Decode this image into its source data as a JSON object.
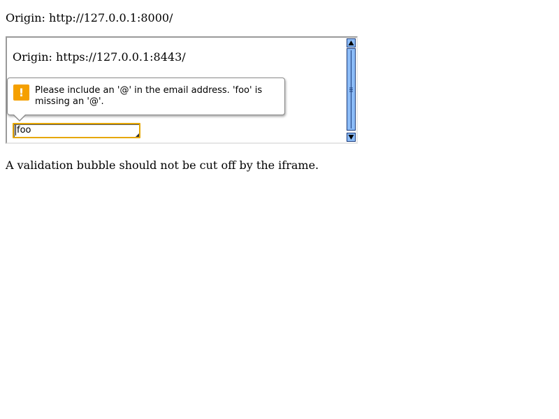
{
  "outer": {
    "origin_text": "Origin: http://127.0.0.1:8000/"
  },
  "iframe": {
    "origin_text": "Origin: https://127.0.0.1:8443/",
    "email_input": {
      "value": "foo"
    },
    "scrollbar": {
      "accent": "#8cbcf7",
      "border": "#1a3a7a"
    }
  },
  "validation_bubble": {
    "icon": "warning-icon",
    "icon_glyph": "!",
    "icon_color": "#f5a000",
    "message": "Please include an '@' in the email address. 'foo' is missing an '@'."
  },
  "caption": {
    "text": "A validation bubble should not be cut off by the iframe."
  }
}
